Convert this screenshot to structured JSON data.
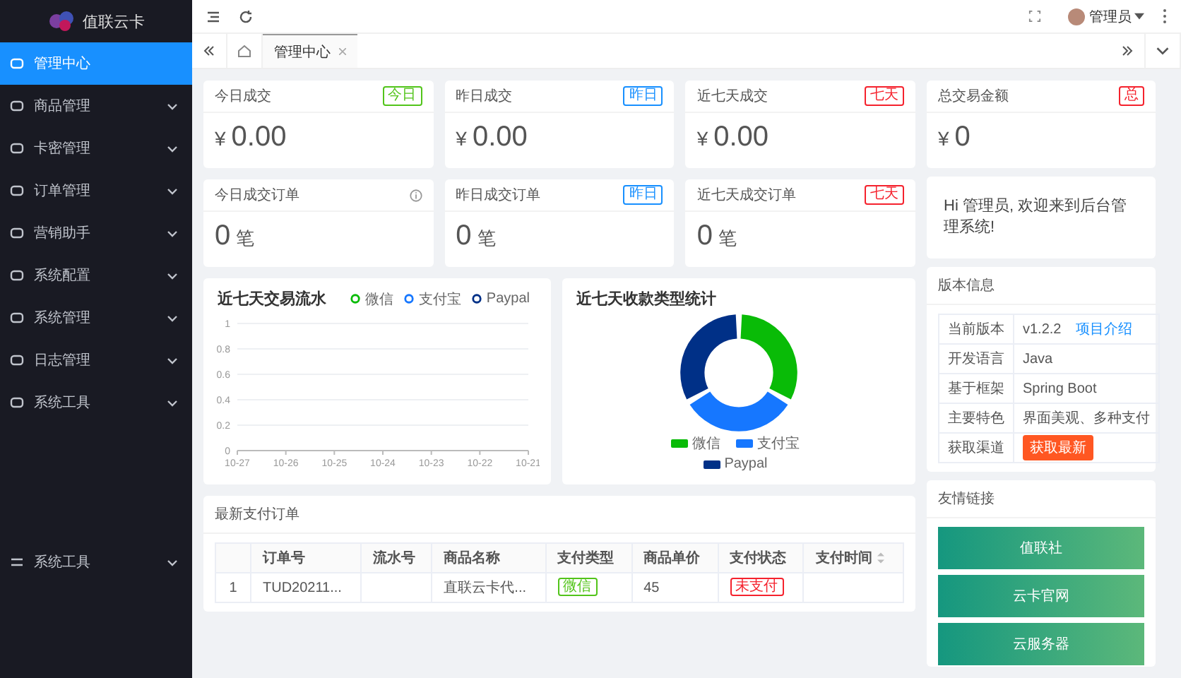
{
  "sidebar": {
    "logo": "值联云卡",
    "items": [
      {
        "label": "管理中心",
        "selected": true,
        "submenu": false
      },
      {
        "label": "商品管理",
        "selected": false,
        "submenu": true
      },
      {
        "label": "卡密管理",
        "selected": false,
        "submenu": true
      },
      {
        "label": "订单管理",
        "selected": false,
        "submenu": true
      },
      {
        "label": "营销助手",
        "selected": false,
        "submenu": true
      },
      {
        "label": "系统配置",
        "selected": false,
        "submenu": true
      },
      {
        "label": "系统管理",
        "selected": false,
        "submenu": true
      },
      {
        "label": "日志管理",
        "selected": false,
        "submenu": true
      },
      {
        "label": "系统工具",
        "selected": false,
        "submenu": true
      }
    ],
    "lower_items": [
      {
        "label": "系统工具",
        "selected": false,
        "submenu": true
      }
    ]
  },
  "header": {
    "user": "管理员"
  },
  "tabs": [
    {
      "label": "管理中心",
      "selected": true
    }
  ],
  "stats": [
    {
      "title": "今日成交",
      "badge": {
        "kind": "tag",
        "text": "今日",
        "color": "#52c41a"
      },
      "currency": "¥",
      "value": "0.00"
    },
    {
      "title": "昨日成交",
      "badge": {
        "kind": "tag",
        "text": "昨日",
        "color": "#1890ff"
      },
      "currency": "¥",
      "value": "0.00"
    },
    {
      "title": "近七天成交",
      "badge": {
        "kind": "tag",
        "text": "七天",
        "color": "#f5222d"
      },
      "currency": "¥",
      "value": "0.00"
    },
    {
      "title": "今日成交订单",
      "badge": {
        "kind": "info"
      },
      "value": "0",
      "unit": "笔"
    },
    {
      "title": "昨日成交订单",
      "badge": {
        "kind": "tag",
        "text": "昨日",
        "color": "#1890ff"
      },
      "value": "0",
      "unit": "笔"
    },
    {
      "title": "近七天成交订单",
      "badge": {
        "kind": "tag",
        "text": "七天",
        "color": "#f5222d"
      },
      "value": "0",
      "unit": "笔"
    }
  ],
  "total": {
    "title": "总交易金额",
    "badge": {
      "kind": "tag",
      "text": "总",
      "color": "#f5222d"
    },
    "currency": "¥",
    "value": "0"
  },
  "greeting": "Hi 管理员, 欢迎来到后台管理系统!",
  "line_chart": {
    "chart_data": {
      "type": "line",
      "title": "近七天交易流水",
      "categories": [
        "10-27",
        "10-26",
        "10-25",
        "10-24",
        "10-23",
        "10-22",
        "10-21"
      ],
      "ylim": [
        0,
        1
      ],
      "grid": true,
      "yticks": [
        0,
        0.2,
        0.4,
        0.6,
        0.8,
        1
      ],
      "series": [
        {
          "name": "微信",
          "color": "#09bb07",
          "values": [
            null,
            null,
            null,
            null,
            null,
            null,
            null
          ]
        },
        {
          "name": "支付宝",
          "color": "#1677ff",
          "values": [
            null,
            null,
            null,
            null,
            null,
            null,
            null
          ]
        },
        {
          "name": "Paypal",
          "color": "#003087",
          "values": [
            null,
            null,
            null,
            null,
            null,
            null,
            null
          ]
        }
      ]
    }
  },
  "donut_chart": {
    "title": "近七天收款类型统计",
    "legend": [
      {
        "name": "微信",
        "color": "#09bb07"
      },
      {
        "name": "支付宝",
        "color": "#1677ff"
      },
      {
        "name": "Paypal",
        "color": "#003087"
      }
    ]
  },
  "orders": {
    "title": "最新支付订单",
    "columns": [
      "订单号",
      "流水号",
      "商品名称",
      "支付类型",
      "商品单价",
      "支付状态",
      "支付时间"
    ],
    "rows": [
      {
        "index": "1",
        "order_no": "TUD20211...",
        "serial": "",
        "product": "直联云卡代...",
        "pay_type": {
          "text": "微信",
          "color": "#52c41a"
        },
        "price": "45",
        "status": {
          "text": "未支付",
          "color": "#f5222d"
        },
        "time": ""
      }
    ]
  },
  "version": {
    "title": "版本信息",
    "rows": [
      {
        "kind": "link",
        "label": "当前版本",
        "value": "v1.2.2",
        "link": "项目介绍"
      },
      {
        "kind": "text",
        "label": "开发语言",
        "value": "Java"
      },
      {
        "kind": "text",
        "label": "基于框架",
        "value": "Spring Boot"
      },
      {
        "kind": "text",
        "label": "主要特色",
        "value": "界面美观、多种支付"
      },
      {
        "kind": "button",
        "label": "获取渠道",
        "value": "获取最新"
      }
    ]
  },
  "links": {
    "title": "友情链接",
    "buttons": [
      "值联社",
      "云卡官网",
      "云服务器"
    ]
  }
}
